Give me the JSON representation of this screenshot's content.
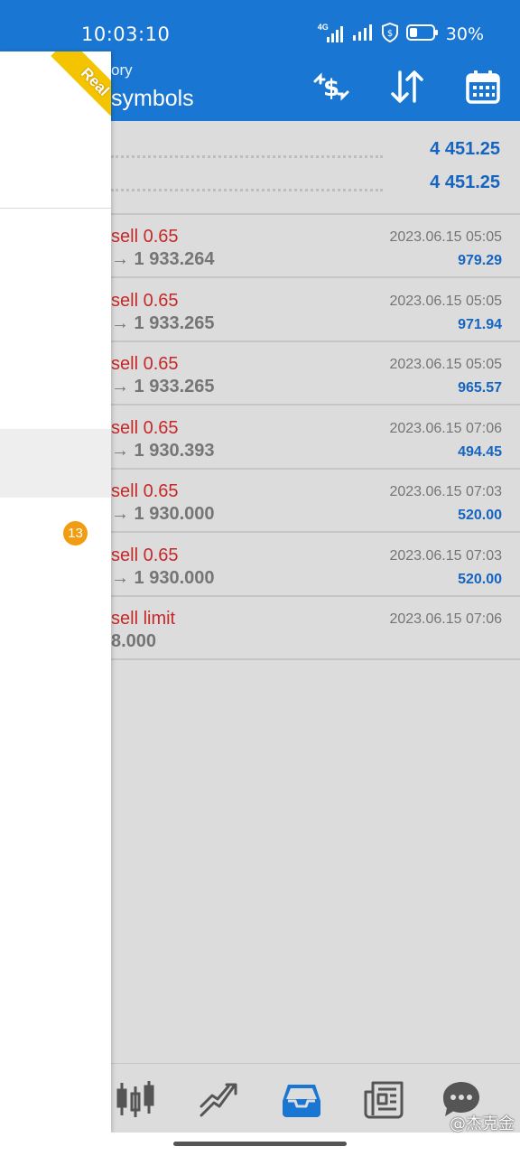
{
  "status_bar": {
    "time": "10:03:10",
    "network_label": "4G",
    "battery_text": "30%"
  },
  "app_bar": {
    "subtitle": "ory",
    "title": "symbols",
    "actions": [
      "exchange-dollar-icon",
      "sort-icon",
      "calendar-icon"
    ]
  },
  "summary": {
    "rows": [
      {
        "value": "4 451.25"
      },
      {
        "value": "4 451.25"
      }
    ]
  },
  "deals": [
    {
      "type": "sell 0.65",
      "prices": "→ 1 933.264",
      "time": "2023.06.15 05:05",
      "profit": "979.29"
    },
    {
      "type": "sell 0.65",
      "prices": "→ 1 933.265",
      "time": "2023.06.15 05:05",
      "profit": "971.94"
    },
    {
      "type": "sell 0.65",
      "prices": "→ 1 933.265",
      "time": "2023.06.15 05:05",
      "profit": "965.57"
    },
    {
      "type": "sell 0.65",
      "prices": "→ 1 930.393",
      "time": "2023.06.15 07:06",
      "profit": "494.45"
    },
    {
      "type": "sell 0.65",
      "prices": "→ 1 930.000",
      "time": "2023.06.15 07:03",
      "profit": "520.00"
    },
    {
      "type": "sell 0.65",
      "prices": "→ 1 930.000",
      "time": "2023.06.15 07:03",
      "profit": "520.00"
    },
    {
      "type": "sell limit",
      "prices": "8.000",
      "time": "2023.06.15 07:06",
      "profit": ""
    }
  ],
  "drawer": {
    "ribbon": "Real",
    "badge_count": "13"
  },
  "bottom_nav": {
    "items": [
      "candlestick-icon",
      "trend-icon",
      "inbox-icon",
      "news-icon",
      "chat-icon"
    ],
    "active_index": 2
  },
  "watermark": "@杰克金",
  "colors": {
    "primary": "#1976d2",
    "sell_red": "#c62828",
    "profit_blue": "#1565c0",
    "badge_orange": "#f39c12",
    "ribbon_yellow": "#f5c400"
  }
}
